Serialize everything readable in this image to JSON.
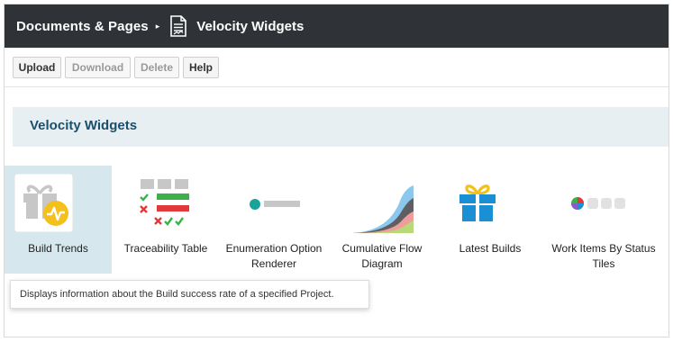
{
  "header": {
    "breadcrumb": "Documents & Pages",
    "separator": "▸",
    "title": "Velocity Widgets"
  },
  "toolbar": {
    "upload_label": "Upload",
    "download_label": "Download",
    "delete_label": "Delete",
    "help_label": "Help"
  },
  "section": {
    "title": "Velocity Widgets"
  },
  "widgets": [
    {
      "label": "Build Trends",
      "icon": "build-trends-icon",
      "selected": true
    },
    {
      "label": "Traceability Table",
      "icon": "traceability-table-icon",
      "selected": false
    },
    {
      "label": "Enumeration Option Renderer",
      "icon": "enumeration-option-icon",
      "selected": false
    },
    {
      "label": "Cumulative Flow Diagram",
      "icon": "cumulative-flow-icon",
      "selected": false
    },
    {
      "label": "Latest Builds",
      "icon": "gift-icon",
      "selected": false
    },
    {
      "label": "Work Items By Status Tiles",
      "icon": "status-tiles-icon",
      "selected": false
    }
  ],
  "tooltip": {
    "text": "Displays information about the Build success rate of a specified Project."
  },
  "colors": {
    "titlebar": "#2f3337",
    "accent_blue": "#1b8fd4",
    "selected_bg": "#d6e8ee",
    "header_text": "#1b4f6b"
  }
}
